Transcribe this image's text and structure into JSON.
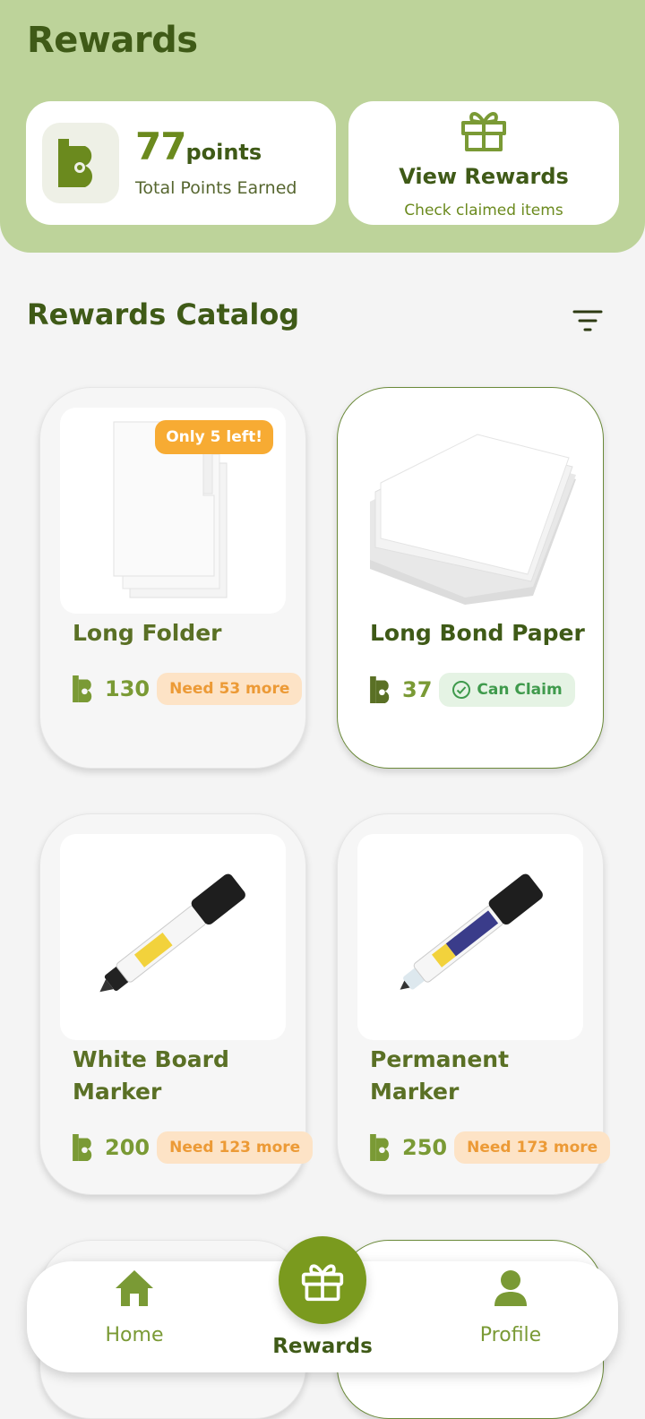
{
  "header": {
    "title": "Rewards",
    "points_value": "77",
    "points_unit": "points",
    "points_caption": "Total Points Earned",
    "view_rewards_title": "View Rewards",
    "view_rewards_sub": "Check claimed items"
  },
  "catalog": {
    "title": "Rewards Catalog",
    "products": [
      {
        "name": "Long Folder",
        "price": "130",
        "status": "Need 53 more",
        "stock": "Only 5 left!"
      },
      {
        "name": "Long Bond Paper",
        "price": "37",
        "status": "Can Claim"
      },
      {
        "name": "White Board Marker",
        "price": "200",
        "status": "Need 123 more"
      },
      {
        "name": "Permanent Marker",
        "price": "250",
        "status": "Need 173 more"
      }
    ]
  },
  "nav": {
    "home": "Home",
    "rewards": "Rewards",
    "profile": "Profile"
  },
  "colors": {
    "header_bg": "#bdd39a",
    "brand_dark": "#3f5a17",
    "brand": "#7a9a1e",
    "need_badge": "#fde3c6",
    "claim_badge": "#e5f3e4"
  },
  "icons": [
    "logo-b-icon",
    "gift-icon",
    "filter-icon",
    "check-circle-icon",
    "home-icon",
    "profile-icon"
  ]
}
